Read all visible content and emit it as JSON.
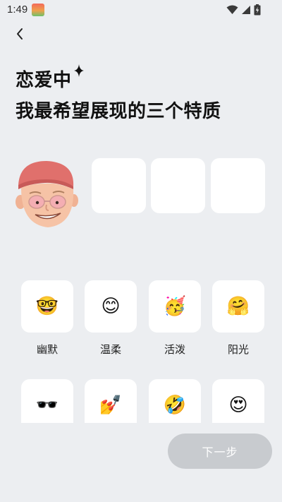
{
  "status_bar": {
    "time": "1:49"
  },
  "header": {
    "title_line1": "恋爱中",
    "title_line2": "我最希望展现的三个特质"
  },
  "traits": [
    {
      "emoji": "🤓",
      "label": "幽默"
    },
    {
      "emoji": "😊",
      "label": "温柔"
    },
    {
      "emoji": "🥳",
      "label": "活泼"
    },
    {
      "emoji": "🤗",
      "label": "阳光"
    },
    {
      "emoji": "🕶️",
      "label": ""
    },
    {
      "emoji": "💅",
      "label": ""
    },
    {
      "emoji": "🤣",
      "label": ""
    },
    {
      "emoji": "😍",
      "label": ""
    }
  ],
  "footer": {
    "next_label": "下一步"
  },
  "colors": {
    "background": "#eceef1",
    "card": "#ffffff",
    "button_disabled": "#c8cbcf"
  }
}
